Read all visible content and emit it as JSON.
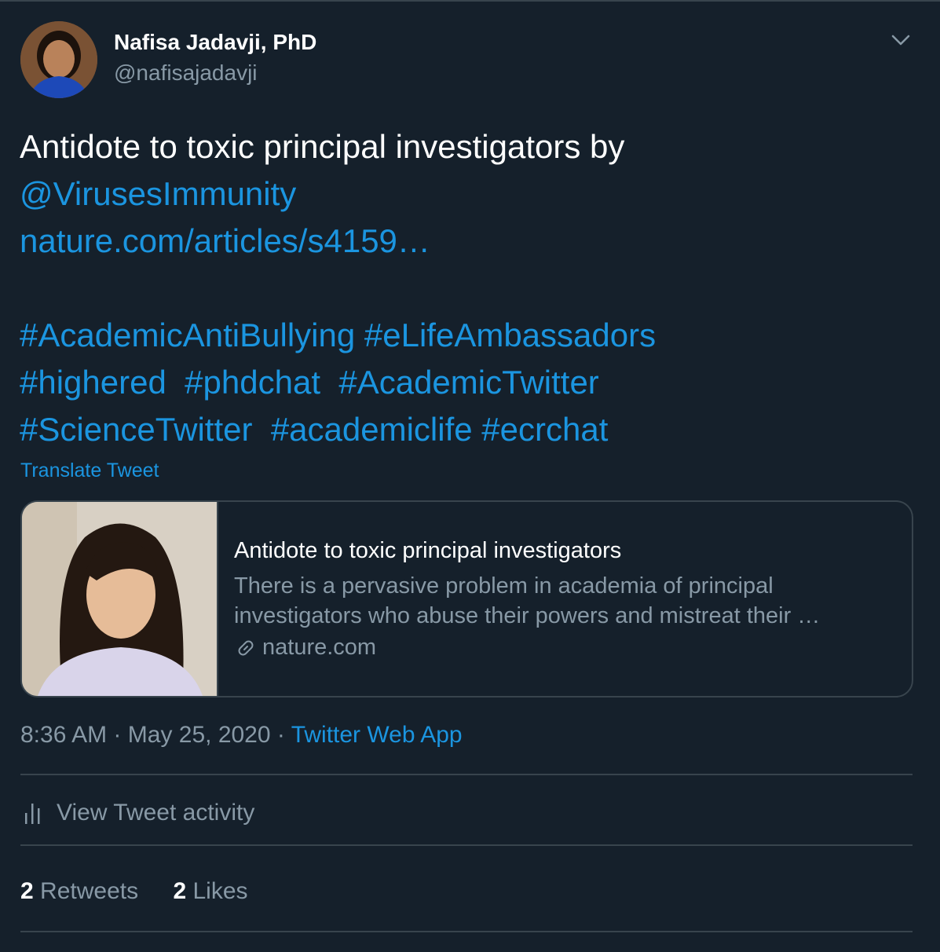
{
  "author": {
    "name": "Nafisa Jadavji, PhD",
    "handle": "@nafisajadavji"
  },
  "tweet": {
    "text_plain": "Antidote to toxic principal investigators by",
    "mention": "@VirusesImmunity",
    "url": "nature.com/articles/s4159…",
    "hashtags_line1": [
      "#AcademicAntiBullying",
      "#eLifeAmbassadors"
    ],
    "hashtags_line2": [
      "#highered",
      "#phdchat",
      "#AcademicTwitter"
    ],
    "hashtags_line3": [
      "#ScienceTwitter",
      "#academiclife",
      "#ecrchat"
    ],
    "translate_label": "Translate Tweet"
  },
  "card": {
    "title": "Antidote to toxic principal investigators",
    "desc_line1": "There is a pervasive problem in academia of principal",
    "desc_line2": "investigators who abuse their powers and mistreat their …",
    "domain": "nature.com"
  },
  "meta": {
    "time": "8:36 AM",
    "date": "May 25, 2020",
    "separator": "·",
    "source": "Twitter Web App"
  },
  "activity": {
    "label": "View Tweet activity"
  },
  "stats": {
    "retweets_count": "2",
    "retweets_label": "Retweets",
    "likes_count": "2",
    "likes_label": "Likes"
  },
  "colors": {
    "background": "#15202b",
    "link": "#1b95e0",
    "secondary_text": "#8899a6",
    "border": "#38444d"
  }
}
